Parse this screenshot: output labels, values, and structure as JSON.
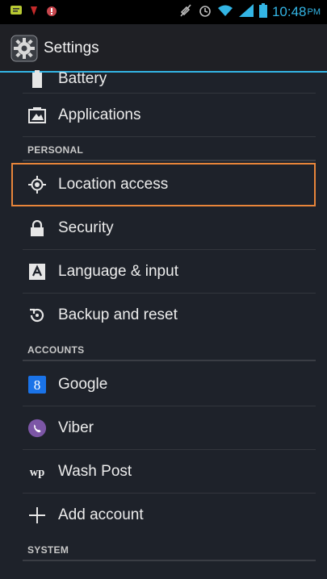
{
  "status_bar": {
    "time": "10:48",
    "ampm": "PM",
    "icons": [
      "messenger-icon",
      "notification-icon",
      "alert-icon",
      "mute-icon",
      "alarm-icon",
      "wifi-icon",
      "signal-icon",
      "battery-icon"
    ]
  },
  "action_bar": {
    "title": "Settings",
    "icon": "settings-gear-icon"
  },
  "rows": {
    "battery": "Battery",
    "applications": "Applications",
    "location": "Location access",
    "security": "Security",
    "language": "Language & input",
    "backup": "Backup and reset",
    "google": "Google",
    "viber": "Viber",
    "washpost": "Wash Post",
    "add_account": "Add account"
  },
  "headers": {
    "personal": "PERSONAL",
    "accounts": "ACCOUNTS",
    "system": "SYSTEM"
  },
  "colors": {
    "accent": "#33b5e5",
    "focus_outline": "#e8853a",
    "google": "#1a73e8",
    "viber": "#7c56a6"
  }
}
